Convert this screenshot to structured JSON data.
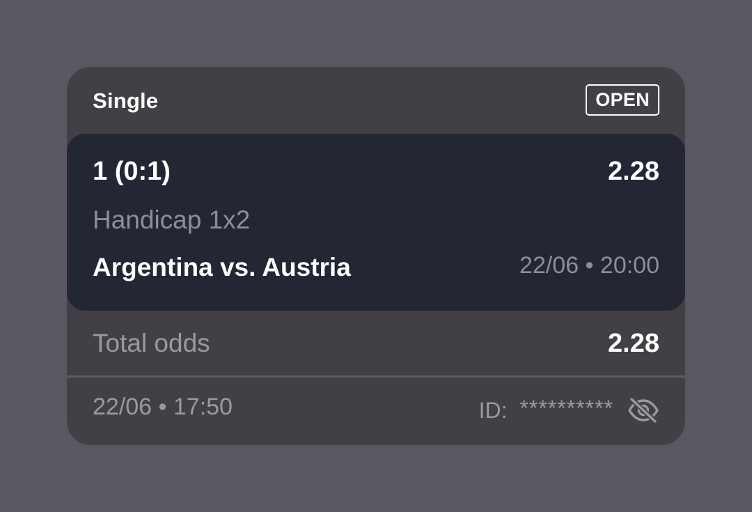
{
  "header": {
    "bet_type": "Single",
    "status": "OPEN"
  },
  "selection": {
    "pick": "1 (0:1)",
    "odds": "2.28",
    "market": "Handicap 1x2",
    "match": "Argentina vs. Austria",
    "match_time": "22/06 • 20:00"
  },
  "totals": {
    "label": "Total odds",
    "value": "2.28"
  },
  "footer": {
    "placed_time": "22/06 • 17:50",
    "id_label": "ID:",
    "id_value": "**********",
    "toggle_icon": "eye-off-icon"
  },
  "colors": {
    "background": "#5a5762",
    "card": "#434045",
    "panel": "#232633",
    "text_primary": "#ffffff",
    "text_muted": "#9a99a0"
  }
}
